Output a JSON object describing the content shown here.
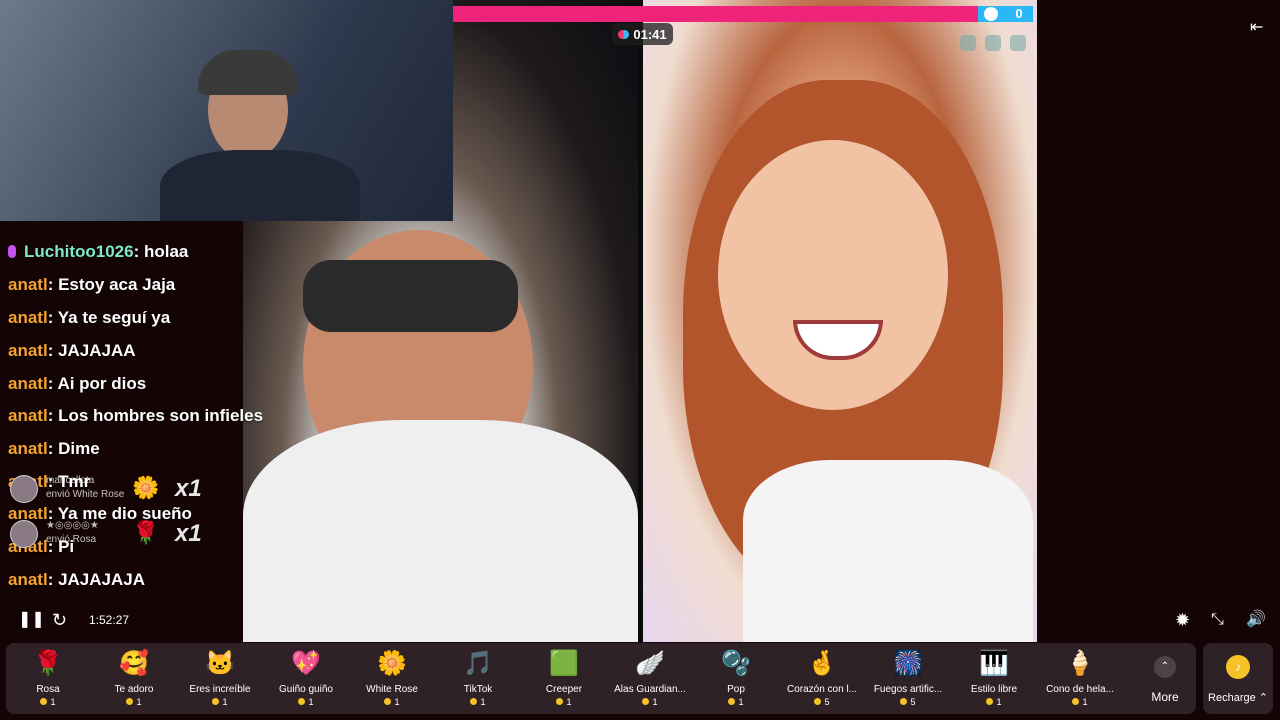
{
  "stream": {
    "timer": "01:41",
    "battle_score": "0",
    "playback_time": "1:52:27"
  },
  "chat": [
    {
      "user": "Luchitoo1026",
      "text": ": holaa",
      "top": 0
    },
    {
      "user": "anatl",
      "text": ": Estoy aca Jaja"
    },
    {
      "user": "anatl",
      "text": ": Ya te seguí ya"
    },
    {
      "user": "anatl",
      "text": ": JAJAJAA"
    },
    {
      "user": "anatl",
      "text": ": Ai por dios"
    },
    {
      "user": "anatl",
      "text": ": Los hombres son infieles"
    },
    {
      "user": "anatl",
      "text": ": Dime"
    },
    {
      "user": "anatl",
      "text": ": Tmr"
    },
    {
      "user": "anatl",
      "text": ": Ya me dio sueño"
    },
    {
      "user": "anatl",
      "text": ": Pi"
    },
    {
      "user": "anatl",
      "text": ": JAJAJAJA"
    }
  ],
  "gift_notifications": [
    {
      "name": "maricellota",
      "sent": "envió White Rose",
      "count": "x1",
      "gift_icon": "white-rose-icon"
    },
    {
      "name": "★◎◎◎◎★",
      "sent": "envió Rosa",
      "count": "x1",
      "gift_icon": "rose-icon"
    }
  ],
  "gifts": [
    {
      "label": "Rosa",
      "price": "1",
      "icon": "🌹"
    },
    {
      "label": "Te adoro",
      "price": "1",
      "icon": "🥰"
    },
    {
      "label": "Eres increíble",
      "price": "1",
      "icon": "🐱"
    },
    {
      "label": "Guiño guiño",
      "price": "1",
      "icon": "💖"
    },
    {
      "label": "White Rose",
      "price": "1",
      "icon": "🌼"
    },
    {
      "label": "TikTok",
      "price": "1",
      "icon": "🎵"
    },
    {
      "label": "Creeper",
      "price": "1",
      "icon": "🟩"
    },
    {
      "label": "Alas Guardian...",
      "price": "1",
      "icon": "🪽"
    },
    {
      "label": "Pop",
      "price": "1",
      "icon": "🫧"
    },
    {
      "label": "Corazón con l...",
      "price": "5",
      "icon": "🤞"
    },
    {
      "label": "Fuegos artific...",
      "price": "5",
      "icon": "🎆"
    },
    {
      "label": "Estilo libre",
      "price": "1",
      "icon": "🎹"
    },
    {
      "label": "Cono de hela...",
      "price": "1",
      "icon": "🍦"
    }
  ],
  "more_label": "More",
  "recharge_label": "Recharge ⌃",
  "colors": {
    "battle_pink": "#f0237a",
    "battle_blue": "#2bb7f5",
    "username": "#f4a331",
    "coin": "#f5c227"
  }
}
